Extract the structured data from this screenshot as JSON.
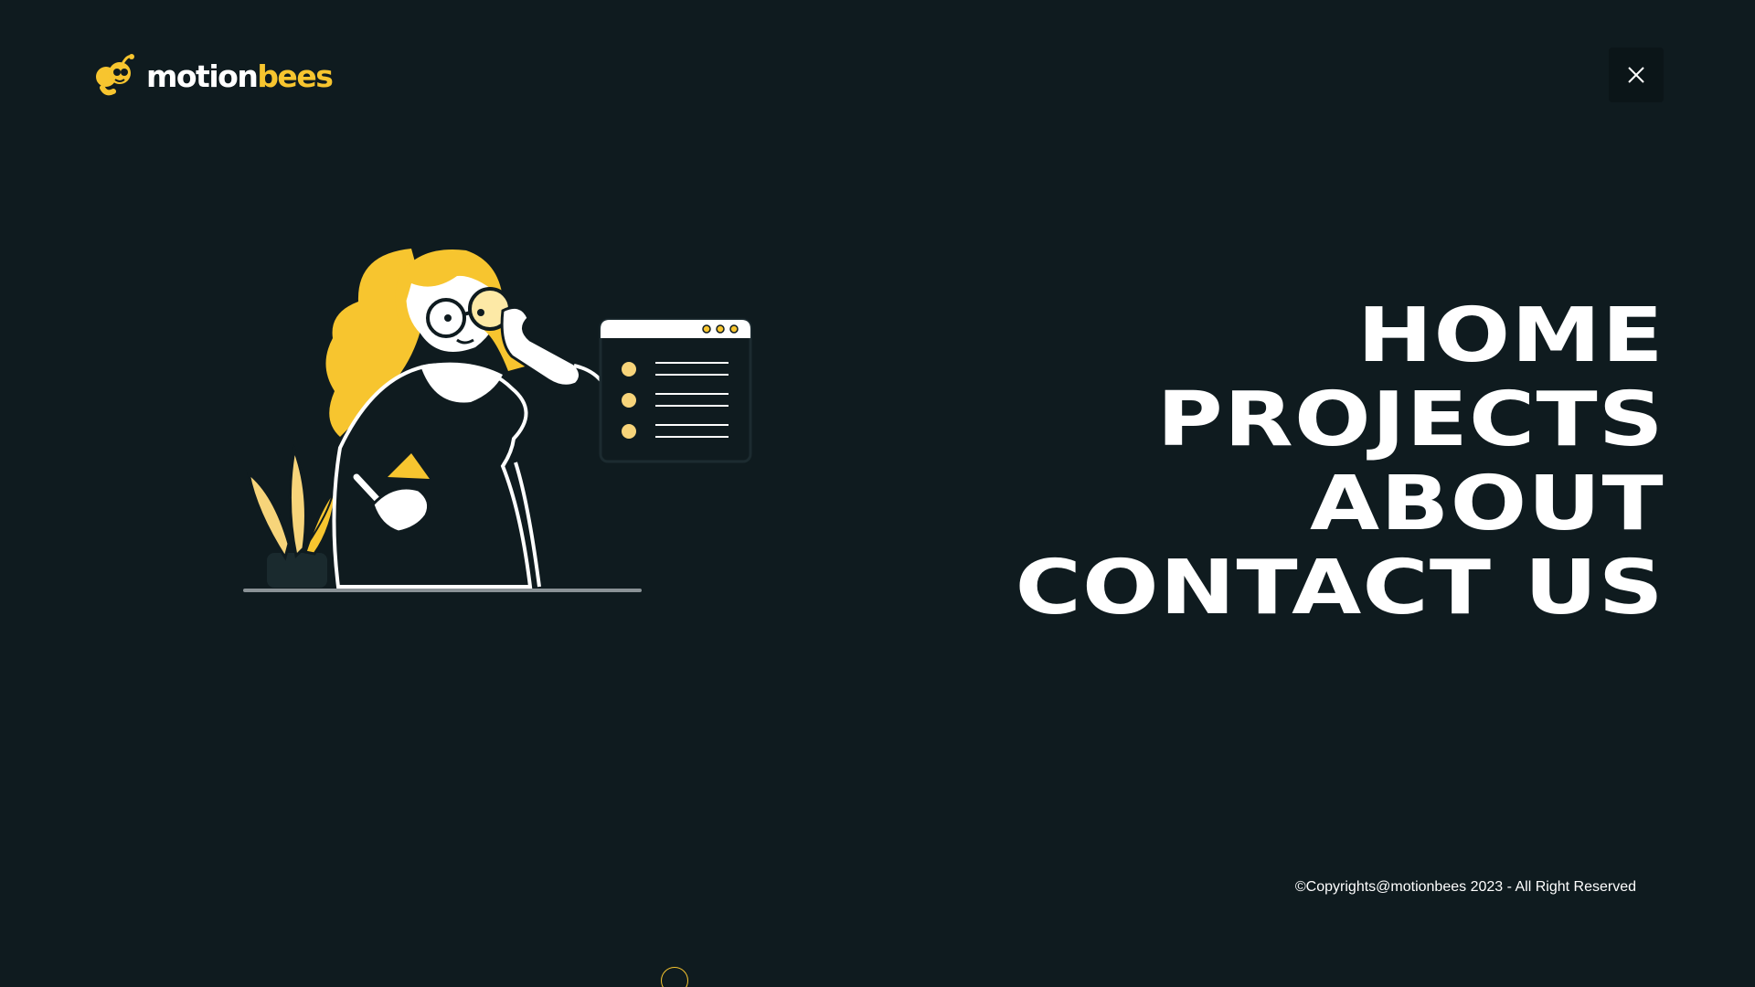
{
  "brand": {
    "name_part1": "motion",
    "name_part2": "bees",
    "accent_color": "#f7c52f",
    "background_color": "#0f1b1f"
  },
  "header": {
    "close_icon": "close-icon"
  },
  "nav": {
    "items": [
      {
        "label": "HOME"
      },
      {
        "label": "PROJECTS"
      },
      {
        "label": "ABOUT"
      },
      {
        "label": "CONTACT US"
      }
    ]
  },
  "footer": {
    "copyright": "©Copyrights@motionbees 2023 - All Right Reserved"
  }
}
